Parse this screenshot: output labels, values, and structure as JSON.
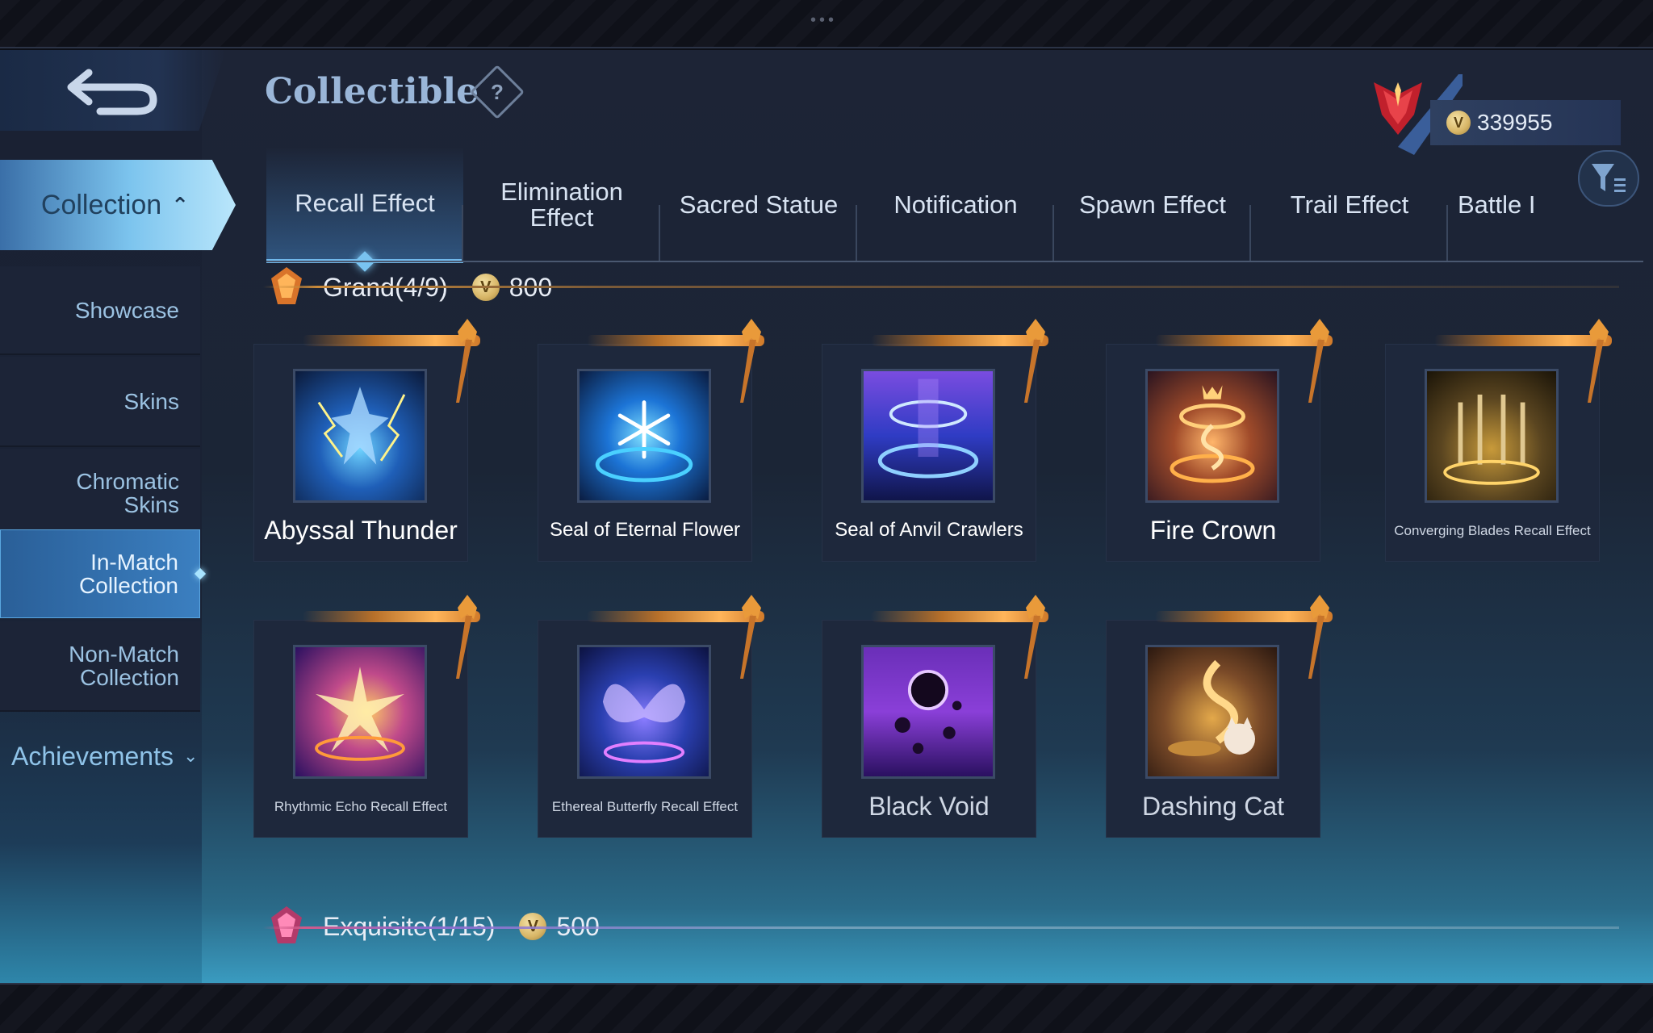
{
  "header": {
    "title": "Collectible",
    "help_label": "?",
    "currency_value": "339955"
  },
  "sidebar": {
    "collection_label": "Collection",
    "items": [
      {
        "label": "Showcase"
      },
      {
        "label": "Skins"
      },
      {
        "label": "Chromatic Skins"
      },
      {
        "label": "In-Match Collection",
        "active": true
      },
      {
        "label": "Non-Match Collection"
      }
    ],
    "achievements_label": "Achievements"
  },
  "tabs": [
    {
      "label": "Recall Effect",
      "active": true
    },
    {
      "label": "Elimination Effect"
    },
    {
      "label": "Sacred Statue"
    },
    {
      "label": "Notification"
    },
    {
      "label": "Spawn Effect"
    },
    {
      "label": "Trail Effect"
    },
    {
      "label": "Battle I"
    }
  ],
  "sections": {
    "grand": {
      "label": "Grand(4/9)",
      "points": "800"
    },
    "exquisite": {
      "label": "Exquisite(1/15)",
      "points": "500"
    }
  },
  "items": [
    {
      "name": "Abyssal Thunder",
      "icon": "thunder-icon"
    },
    {
      "name": "Seal of Eternal Flower",
      "icon": "snowflake-icon"
    },
    {
      "name": "Seal of Anvil Crawlers",
      "icon": "portal-ring-icon"
    },
    {
      "name": "Fire Crown",
      "icon": "fire-ring-icon"
    },
    {
      "name": "Converging Blades Recall Effect",
      "icon": "blades-icon"
    },
    {
      "name": "Rhythmic Echo Recall Effect",
      "icon": "burst-icon"
    },
    {
      "name": "Ethereal Butterfly Recall Effect",
      "icon": "butterfly-icon"
    },
    {
      "name": "Black Void",
      "icon": "void-moon-icon"
    },
    {
      "name": "Dashing Cat",
      "icon": "cat-icon"
    }
  ],
  "colors": {
    "accent": "#70b7ea",
    "gold": "#ffb55a",
    "exquisite": "#d05a8a"
  }
}
